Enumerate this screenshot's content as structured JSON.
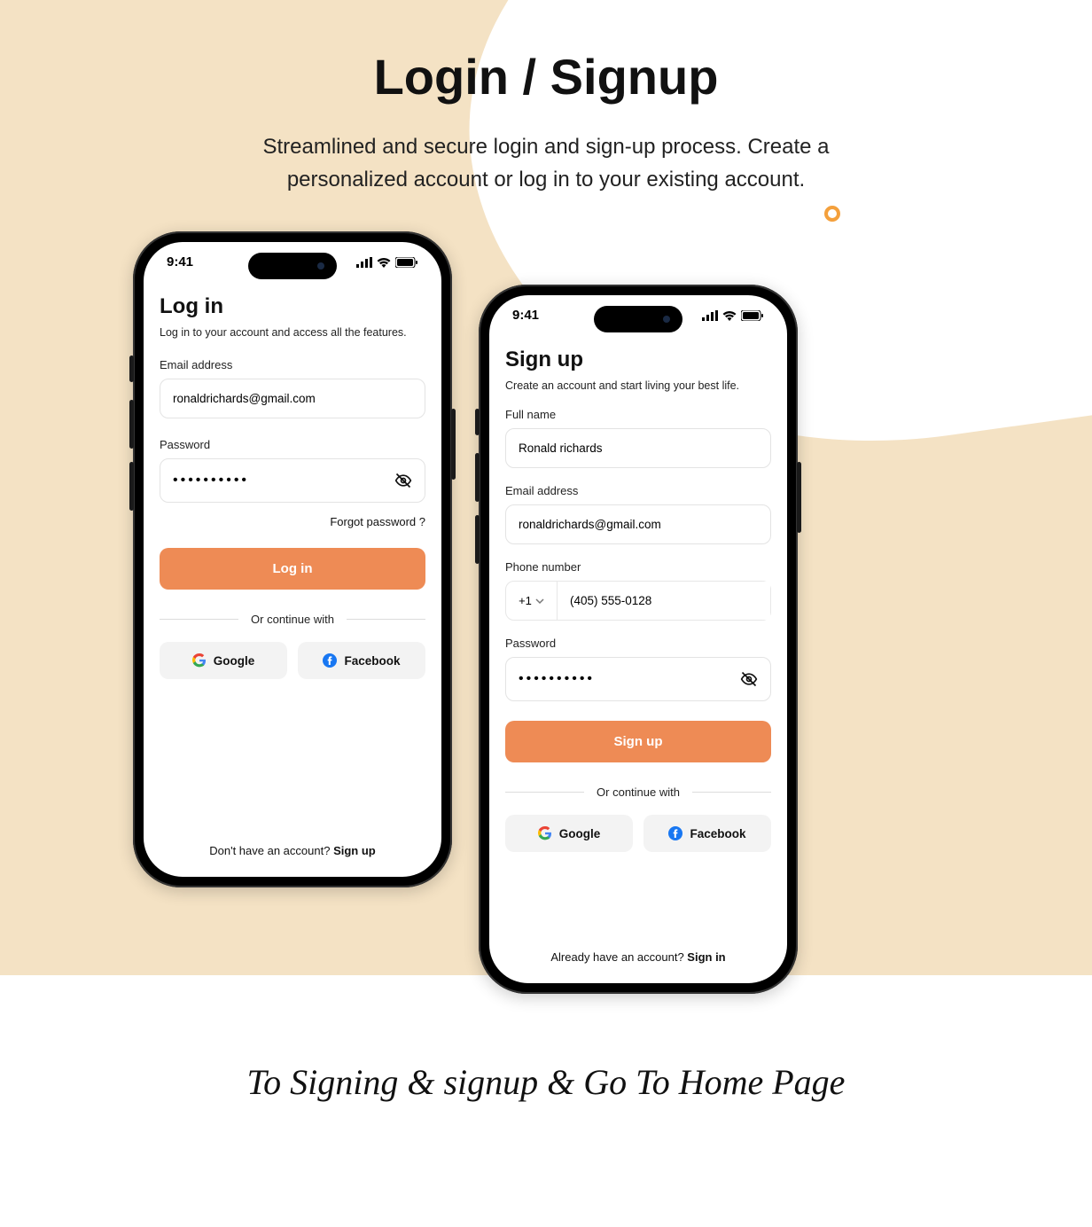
{
  "page": {
    "title": "Login / Signup",
    "subtitle": "Streamlined and secure login and sign-up process. Create a personalized account or log in to your existing account.",
    "footer_script": "To Signing & signup & Go To Home Page"
  },
  "status_bar": {
    "time": "9:41"
  },
  "login": {
    "title": "Log in",
    "subtitle": "Log in to your account and access all the features.",
    "email_label": "Email address",
    "email_value": "ronaldrichards@gmail.com",
    "password_label": "Password",
    "password_value": "••••••••••",
    "forgot": "Forgot password ?",
    "cta": "Log in",
    "divider": "Or continue with",
    "google": "Google",
    "facebook": "Facebook",
    "switch_prefix": "Don't have an account? ",
    "switch_action": "Sign up"
  },
  "signup": {
    "title": "Sign up",
    "subtitle": "Create an account and start living your best life.",
    "fullname_label": "Full name",
    "fullname_value": "Ronald richards",
    "email_label": "Email address",
    "email_value": "ronaldrichards@gmail.com",
    "phone_label": "Phone number",
    "dial_code": "+1",
    "phone_value": "(405) 555-0128",
    "password_label": "Password",
    "password_value": "••••••••••",
    "cta": "Sign up",
    "divider": "Or continue with",
    "google": "Google",
    "facebook": "Facebook",
    "switch_prefix": "Already have an account? ",
    "switch_action": "Sign in"
  },
  "accent": "#ee8b55"
}
